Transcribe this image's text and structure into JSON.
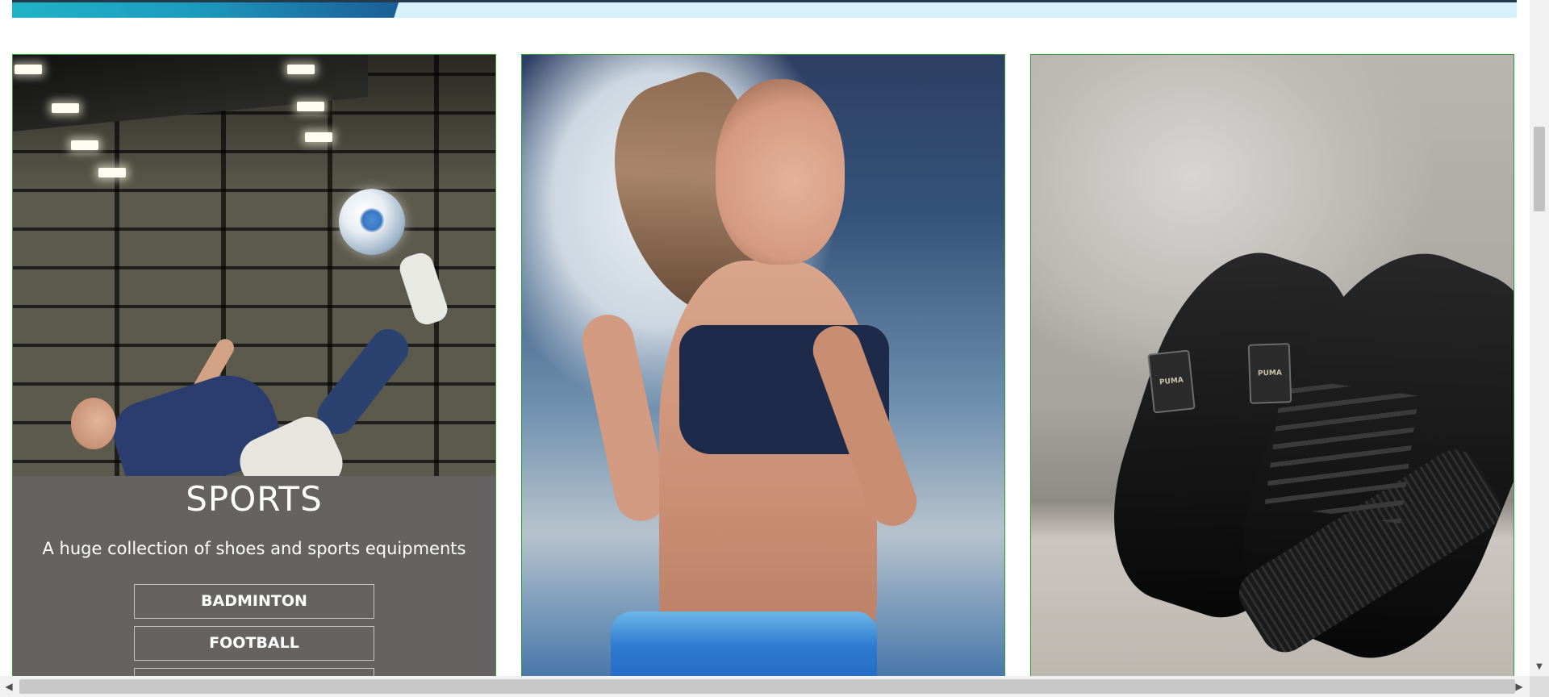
{
  "featured_card": {
    "title": "SPORTS",
    "description": "A huge collection of shoes and sports equipments",
    "categories": [
      {
        "label": "BADMINTON"
      },
      {
        "label": "FOOTBALL"
      },
      {
        "label": ""
      }
    ]
  },
  "shoe_tags": {
    "left": "PUMA",
    "right": "PUMA"
  },
  "images": [
    {
      "icon": "football-player-photo"
    },
    {
      "icon": "runner-photo"
    },
    {
      "icon": "black-sneakers-photo"
    }
  ],
  "scrollbars": {
    "left_arrow": "◀",
    "right_arrow": "▶",
    "down_arrow": "▼"
  },
  "colors": {
    "panel_background": "#676262",
    "card_border": "#2f9e2f",
    "banner_background": "#d7f1fc",
    "banner_accent": "#1d9dbf"
  }
}
